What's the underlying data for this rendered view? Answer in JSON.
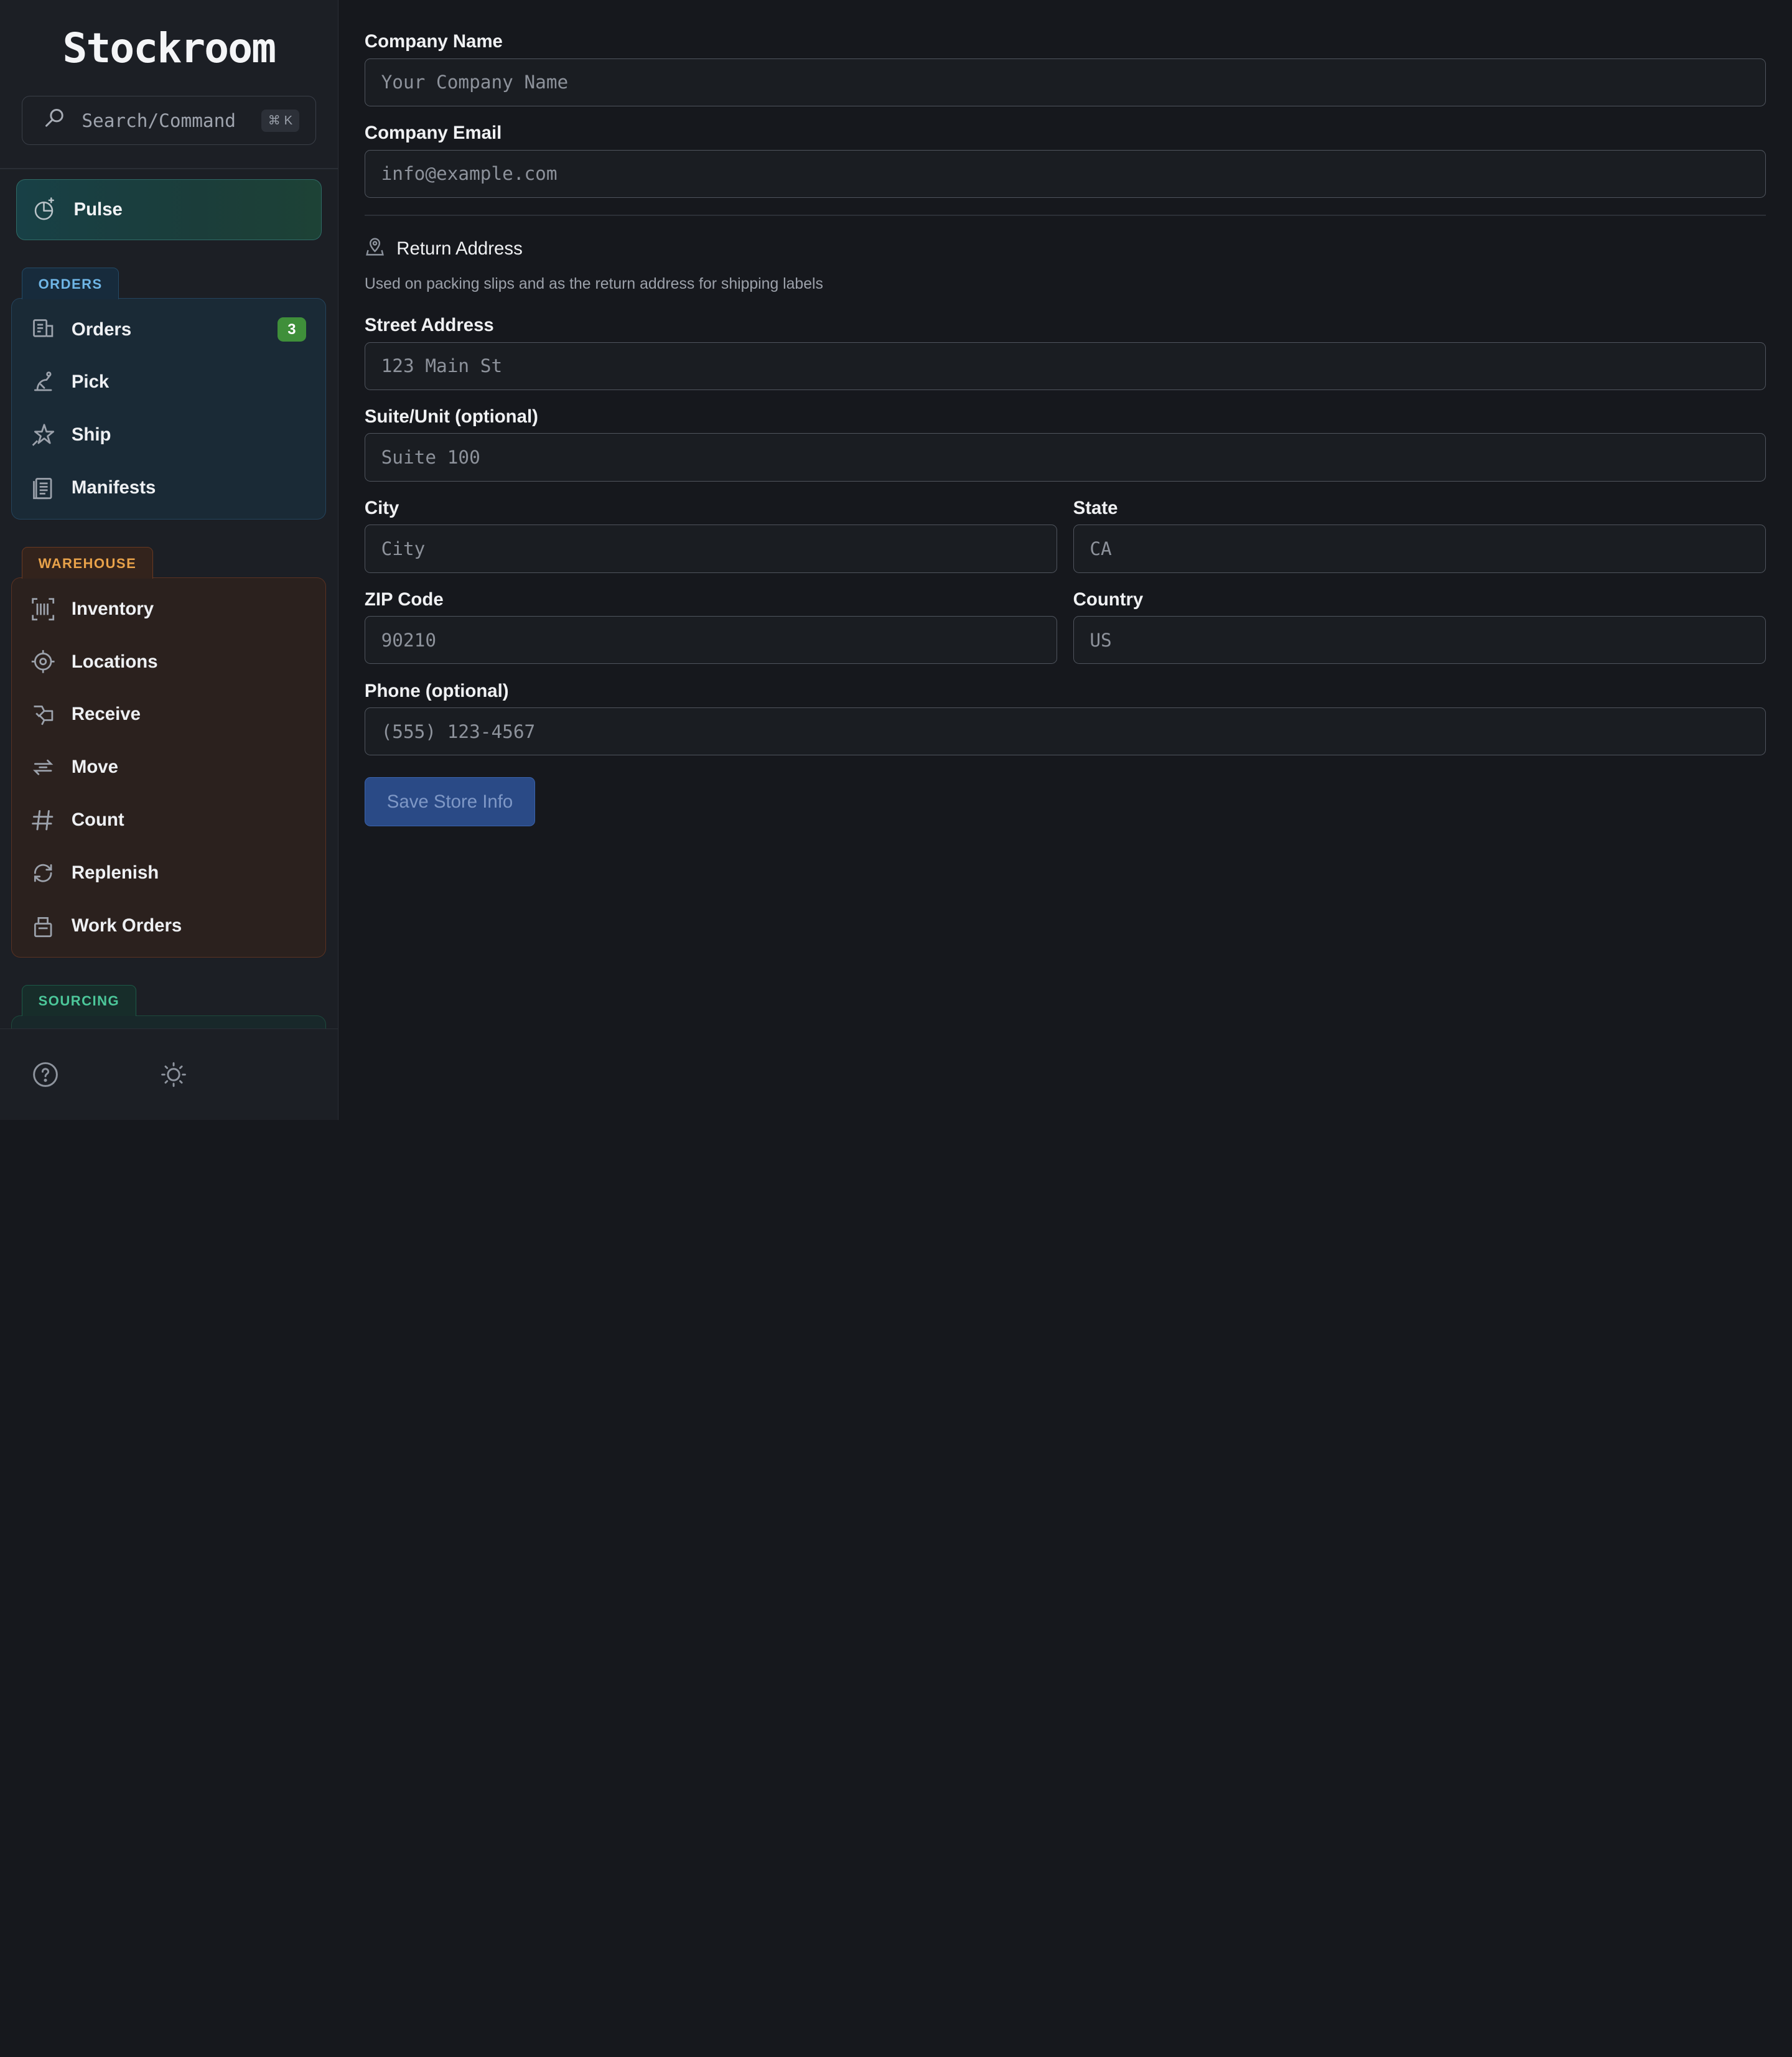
{
  "sidebar": {
    "brand": "Stockroom",
    "search": {
      "label": "Search/Command",
      "shortcut": "⌘ K"
    },
    "pulse": {
      "label": "Pulse"
    },
    "groups": {
      "orders": {
        "tag": "ORDERS",
        "items": [
          {
            "label": "Orders",
            "badge": "3",
            "icon": "orders-icon"
          },
          {
            "label": "Pick",
            "icon": "pick-icon"
          },
          {
            "label": "Ship",
            "icon": "ship-icon"
          },
          {
            "label": "Manifests",
            "icon": "manifests-icon"
          }
        ]
      },
      "warehouse": {
        "tag": "WAREHOUSE",
        "items": [
          {
            "label": "Inventory",
            "icon": "barcode-icon"
          },
          {
            "label": "Locations",
            "icon": "target-icon"
          },
          {
            "label": "Receive",
            "icon": "receive-icon"
          },
          {
            "label": "Move",
            "icon": "move-arrows-icon"
          },
          {
            "label": "Count",
            "icon": "hash-icon"
          },
          {
            "label": "Replenish",
            "icon": "replenish-icon"
          },
          {
            "label": "Work Orders",
            "icon": "work-orders-icon"
          }
        ]
      },
      "sourcing": {
        "tag": "SOURCING"
      }
    },
    "footer": {
      "help_icon": "help-icon",
      "theme_icon": "sun-icon"
    }
  },
  "form": {
    "company_name": {
      "label": "Company Name",
      "placeholder": "Your Company Name"
    },
    "company_email": {
      "label": "Company Email",
      "placeholder": "info@example.com"
    },
    "return_address": {
      "title": "Return Address",
      "description": "Used on packing slips and as the return address for shipping labels"
    },
    "street": {
      "label": "Street Address",
      "placeholder": "123 Main St"
    },
    "suite": {
      "label": "Suite/Unit (optional)",
      "placeholder": "Suite 100"
    },
    "city": {
      "label": "City",
      "placeholder": "City"
    },
    "state": {
      "label": "State",
      "placeholder": "CA"
    },
    "zip": {
      "label": "ZIP Code",
      "placeholder": "90210"
    },
    "country": {
      "label": "Country",
      "placeholder": "US"
    },
    "phone": {
      "label": "Phone (optional)",
      "placeholder": "(555) 123-4567"
    },
    "save_label": "Save Store Info"
  },
  "colors": {
    "accent": "#2a4a86",
    "orders_group": "#6fb6e6",
    "warehouse_group": "#e8a24a",
    "sourcing_group": "#4cc79a",
    "badge": "#3f8f3a"
  }
}
